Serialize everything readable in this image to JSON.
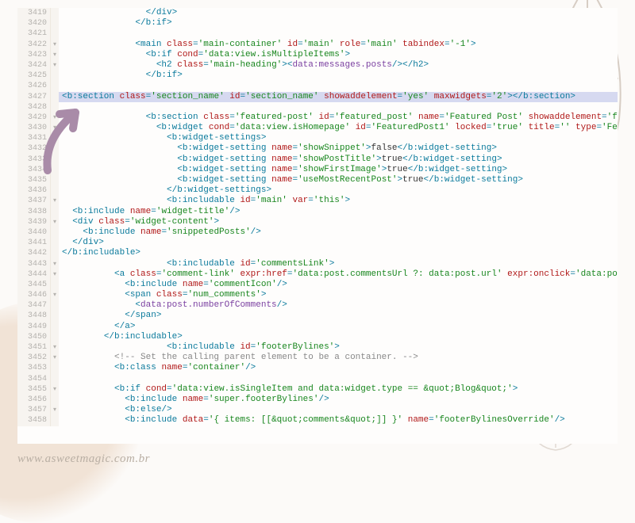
{
  "watermark": "www.asweetmagic.com.br",
  "lines": [
    {
      "num": "3419",
      "fold": "",
      "hl": false,
      "tokens": [
        [
          "t-text",
          "                "
        ],
        [
          "t-tag",
          "</div>"
        ]
      ]
    },
    {
      "num": "3420",
      "fold": "",
      "hl": false,
      "tokens": [
        [
          "t-text",
          "              "
        ],
        [
          "t-tag",
          "</b:if>"
        ]
      ]
    },
    {
      "num": "3421",
      "fold": "",
      "hl": false,
      "tokens": []
    },
    {
      "num": "3422",
      "fold": "▾",
      "hl": false,
      "tokens": [
        [
          "t-text",
          "              "
        ],
        [
          "t-tag",
          "<main "
        ],
        [
          "t-attr",
          "class"
        ],
        [
          "t-tag",
          "="
        ],
        [
          "t-str",
          "'main-container'"
        ],
        [
          "t-tag",
          " "
        ],
        [
          "t-attr",
          "id"
        ],
        [
          "t-tag",
          "="
        ],
        [
          "t-str",
          "'main'"
        ],
        [
          "t-tag",
          " "
        ],
        [
          "t-attr",
          "role"
        ],
        [
          "t-tag",
          "="
        ],
        [
          "t-str",
          "'main'"
        ],
        [
          "t-tag",
          " "
        ],
        [
          "t-attr",
          "tabindex"
        ],
        [
          "t-tag",
          "="
        ],
        [
          "t-str",
          "'-1'"
        ],
        [
          "t-tag",
          ">"
        ]
      ]
    },
    {
      "num": "3423",
      "fold": "▾",
      "hl": false,
      "tokens": [
        [
          "t-text",
          "                "
        ],
        [
          "t-tag",
          "<b:if "
        ],
        [
          "t-attr",
          "cond"
        ],
        [
          "t-tag",
          "="
        ],
        [
          "t-str",
          "'data:view.isMultipleItems'"
        ],
        [
          "t-tag",
          ">"
        ]
      ]
    },
    {
      "num": "3424",
      "fold": "▾",
      "hl": false,
      "tokens": [
        [
          "t-text",
          "                  "
        ],
        [
          "t-tag",
          "<h2 "
        ],
        [
          "t-attr",
          "class"
        ],
        [
          "t-tag",
          "="
        ],
        [
          "t-str",
          "'main-heading'"
        ],
        [
          "t-tag",
          "><"
        ],
        [
          "t-func",
          "data:messages.posts"
        ],
        [
          "t-tag",
          "/></h2>"
        ]
      ]
    },
    {
      "num": "3425",
      "fold": "",
      "hl": false,
      "tokens": [
        [
          "t-text",
          "                "
        ],
        [
          "t-tag",
          "</b:if>"
        ]
      ]
    },
    {
      "num": "3426",
      "fold": "",
      "hl": false,
      "tokens": []
    },
    {
      "num": "3427",
      "fold": "",
      "hl": true,
      "tokens": [
        [
          "t-tag",
          "<b:section "
        ],
        [
          "t-attr",
          "class"
        ],
        [
          "t-tag",
          "="
        ],
        [
          "t-str",
          "'section_name'"
        ],
        [
          "t-tag",
          " "
        ],
        [
          "t-attr",
          "id"
        ],
        [
          "t-tag",
          "="
        ],
        [
          "t-str",
          "'section_name'"
        ],
        [
          "t-tag",
          " "
        ],
        [
          "t-attr",
          "showaddelement"
        ],
        [
          "t-tag",
          "="
        ],
        [
          "t-str",
          "'yes'"
        ],
        [
          "t-tag",
          " "
        ],
        [
          "t-attr",
          "maxwidgets"
        ],
        [
          "t-tag",
          "="
        ],
        [
          "t-str",
          "'2'"
        ],
        [
          "t-tag",
          "></b:section>"
        ]
      ]
    },
    {
      "num": "3428",
      "fold": "",
      "hl": false,
      "tokens": []
    },
    {
      "num": "3429",
      "fold": "▾",
      "hl": false,
      "tokens": [
        [
          "t-text",
          "                "
        ],
        [
          "t-tag",
          "<b:section "
        ],
        [
          "t-attr",
          "class"
        ],
        [
          "t-tag",
          "="
        ],
        [
          "t-str",
          "'featured-post'"
        ],
        [
          "t-tag",
          " "
        ],
        [
          "t-attr",
          "id"
        ],
        [
          "t-tag",
          "="
        ],
        [
          "t-str",
          "'featured_post'"
        ],
        [
          "t-tag",
          " "
        ],
        [
          "t-attr",
          "name"
        ],
        [
          "t-tag",
          "="
        ],
        [
          "t-str",
          "'Featured Post'"
        ],
        [
          "t-tag",
          " "
        ],
        [
          "t-attr",
          "showaddelement"
        ],
        [
          "t-tag",
          "="
        ],
        [
          "t-str",
          "'false'"
        ],
        [
          "t-tag",
          ">"
        ]
      ]
    },
    {
      "num": "3430",
      "fold": "▾",
      "hl": false,
      "tokens": [
        [
          "t-text",
          "                  "
        ],
        [
          "t-tag",
          "<b:widget "
        ],
        [
          "t-attr",
          "cond"
        ],
        [
          "t-tag",
          "="
        ],
        [
          "t-str",
          "'data:view.isHomepage'"
        ],
        [
          "t-tag",
          " "
        ],
        [
          "t-attr",
          "id"
        ],
        [
          "t-tag",
          "="
        ],
        [
          "t-str",
          "'FeaturedPost1'"
        ],
        [
          "t-tag",
          " "
        ],
        [
          "t-attr",
          "locked"
        ],
        [
          "t-tag",
          "="
        ],
        [
          "t-str",
          "'true'"
        ],
        [
          "t-tag",
          " "
        ],
        [
          "t-attr",
          "title"
        ],
        [
          "t-tag",
          "="
        ],
        [
          "t-str",
          "''"
        ],
        [
          "t-tag",
          " "
        ],
        [
          "t-attr",
          "type"
        ],
        [
          "t-tag",
          "="
        ],
        [
          "t-str",
          "'Featured"
        ]
      ]
    },
    {
      "num": "3431",
      "fold": "▾",
      "hl": false,
      "tokens": [
        [
          "t-text",
          "                    "
        ],
        [
          "t-tag",
          "<b:widget-settings>"
        ]
      ]
    },
    {
      "num": "3432",
      "fold": "",
      "hl": false,
      "tokens": [
        [
          "t-text",
          "                      "
        ],
        [
          "t-tag",
          "<b:widget-setting "
        ],
        [
          "t-attr",
          "name"
        ],
        [
          "t-tag",
          "="
        ],
        [
          "t-str",
          "'showSnippet'"
        ],
        [
          "t-tag",
          ">"
        ],
        [
          "t-text",
          "false"
        ],
        [
          "t-tag",
          "</b:widget-setting>"
        ]
      ]
    },
    {
      "num": "3433",
      "fold": "",
      "hl": false,
      "tokens": [
        [
          "t-text",
          "                      "
        ],
        [
          "t-tag",
          "<b:widget-setting "
        ],
        [
          "t-attr",
          "name"
        ],
        [
          "t-tag",
          "="
        ],
        [
          "t-str",
          "'showPostTitle'"
        ],
        [
          "t-tag",
          ">"
        ],
        [
          "t-text",
          "true"
        ],
        [
          "t-tag",
          "</b:widget-setting>"
        ]
      ]
    },
    {
      "num": "3434",
      "fold": "",
      "hl": false,
      "tokens": [
        [
          "t-text",
          "                      "
        ],
        [
          "t-tag",
          "<b:widget-setting "
        ],
        [
          "t-attr",
          "name"
        ],
        [
          "t-tag",
          "="
        ],
        [
          "t-str",
          "'showFirstImage'"
        ],
        [
          "t-tag",
          ">"
        ],
        [
          "t-text",
          "true"
        ],
        [
          "t-tag",
          "</b:widget-setting>"
        ]
      ]
    },
    {
      "num": "3435",
      "fold": "",
      "hl": false,
      "tokens": [
        [
          "t-text",
          "                      "
        ],
        [
          "t-tag",
          "<b:widget-setting "
        ],
        [
          "t-attr",
          "name"
        ],
        [
          "t-tag",
          "="
        ],
        [
          "t-str",
          "'useMostRecentPost'"
        ],
        [
          "t-tag",
          ">"
        ],
        [
          "t-text",
          "true"
        ],
        [
          "t-tag",
          "</b:widget-setting>"
        ]
      ]
    },
    {
      "num": "3436",
      "fold": "",
      "hl": false,
      "tokens": [
        [
          "t-text",
          "                    "
        ],
        [
          "t-tag",
          "</b:widget-settings>"
        ]
      ]
    },
    {
      "num": "3437",
      "fold": "▾",
      "hl": false,
      "tokens": [
        [
          "t-text",
          "                    "
        ],
        [
          "t-tag",
          "<b:includable "
        ],
        [
          "t-attr",
          "id"
        ],
        [
          "t-tag",
          "="
        ],
        [
          "t-str",
          "'main'"
        ],
        [
          "t-tag",
          " "
        ],
        [
          "t-attr",
          "var"
        ],
        [
          "t-tag",
          "="
        ],
        [
          "t-str",
          "'this'"
        ],
        [
          "t-tag",
          ">"
        ]
      ]
    },
    {
      "num": "3438",
      "fold": "",
      "hl": false,
      "tokens": [
        [
          "t-text",
          "  "
        ],
        [
          "t-tag",
          "<b:include "
        ],
        [
          "t-attr",
          "name"
        ],
        [
          "t-tag",
          "="
        ],
        [
          "t-str",
          "'widget-title'"
        ],
        [
          "t-tag",
          "/>"
        ]
      ]
    },
    {
      "num": "3439",
      "fold": "▾",
      "hl": false,
      "tokens": [
        [
          "t-text",
          "  "
        ],
        [
          "t-tag",
          "<div "
        ],
        [
          "t-attr",
          "class"
        ],
        [
          "t-tag",
          "="
        ],
        [
          "t-str",
          "'widget-content'"
        ],
        [
          "t-tag",
          ">"
        ]
      ]
    },
    {
      "num": "3440",
      "fold": "",
      "hl": false,
      "tokens": [
        [
          "t-text",
          "    "
        ],
        [
          "t-tag",
          "<b:include "
        ],
        [
          "t-attr",
          "name"
        ],
        [
          "t-tag",
          "="
        ],
        [
          "t-str",
          "'snippetedPosts'"
        ],
        [
          "t-tag",
          "/>"
        ]
      ]
    },
    {
      "num": "3441",
      "fold": "",
      "hl": false,
      "tokens": [
        [
          "t-text",
          "  "
        ],
        [
          "t-tag",
          "</div>"
        ]
      ]
    },
    {
      "num": "3442",
      "fold": "",
      "hl": false,
      "tokens": [
        [
          "t-tag",
          "</b:includable>"
        ]
      ]
    },
    {
      "num": "3443",
      "fold": "▾",
      "hl": false,
      "tokens": [
        [
          "t-text",
          "                    "
        ],
        [
          "t-tag",
          "<b:includable "
        ],
        [
          "t-attr",
          "id"
        ],
        [
          "t-tag",
          "="
        ],
        [
          "t-str",
          "'commentsLink'"
        ],
        [
          "t-tag",
          ">"
        ]
      ]
    },
    {
      "num": "3444",
      "fold": "▾",
      "hl": false,
      "tokens": [
        [
          "t-text",
          "          "
        ],
        [
          "t-tag",
          "<a "
        ],
        [
          "t-attr",
          "class"
        ],
        [
          "t-tag",
          "="
        ],
        [
          "t-str",
          "'comment-link'"
        ],
        [
          "t-tag",
          " "
        ],
        [
          "t-attr",
          "expr:href"
        ],
        [
          "t-tag",
          "="
        ],
        [
          "t-str",
          "'data:post.commentsUrl ?: data:post.url'"
        ],
        [
          "t-tag",
          " "
        ],
        [
          "t-attr",
          "expr:onclick"
        ],
        [
          "t-tag",
          "="
        ],
        [
          "t-str",
          "'data:post.com"
        ]
      ]
    },
    {
      "num": "3445",
      "fold": "",
      "hl": false,
      "tokens": [
        [
          "t-text",
          "            "
        ],
        [
          "t-tag",
          "<b:include "
        ],
        [
          "t-attr",
          "name"
        ],
        [
          "t-tag",
          "="
        ],
        [
          "t-str",
          "'commentIcon'"
        ],
        [
          "t-tag",
          "/>"
        ]
      ]
    },
    {
      "num": "3446",
      "fold": "▾",
      "hl": false,
      "tokens": [
        [
          "t-text",
          "            "
        ],
        [
          "t-tag",
          "<span "
        ],
        [
          "t-attr",
          "class"
        ],
        [
          "t-tag",
          "="
        ],
        [
          "t-str",
          "'num_comments'"
        ],
        [
          "t-tag",
          ">"
        ]
      ]
    },
    {
      "num": "3447",
      "fold": "",
      "hl": false,
      "tokens": [
        [
          "t-text",
          "              "
        ],
        [
          "t-tag",
          "<"
        ],
        [
          "t-func",
          "data:post.numberOfComments"
        ],
        [
          "t-tag",
          "/>"
        ]
      ]
    },
    {
      "num": "3448",
      "fold": "",
      "hl": false,
      "tokens": [
        [
          "t-text",
          "            "
        ],
        [
          "t-tag",
          "</span>"
        ]
      ]
    },
    {
      "num": "3449",
      "fold": "",
      "hl": false,
      "tokens": [
        [
          "t-text",
          "          "
        ],
        [
          "t-tag",
          "</a>"
        ]
      ]
    },
    {
      "num": "3450",
      "fold": "",
      "hl": false,
      "tokens": [
        [
          "t-text",
          "        "
        ],
        [
          "t-tag",
          "</b:includable>"
        ]
      ]
    },
    {
      "num": "3451",
      "fold": "▾",
      "hl": false,
      "tokens": [
        [
          "t-text",
          "                    "
        ],
        [
          "t-tag",
          "<b:includable "
        ],
        [
          "t-attr",
          "id"
        ],
        [
          "t-tag",
          "="
        ],
        [
          "t-str",
          "'footerBylines'"
        ],
        [
          "t-tag",
          ">"
        ]
      ]
    },
    {
      "num": "3452",
      "fold": "▾",
      "hl": false,
      "tokens": [
        [
          "t-text",
          "          "
        ],
        [
          "t-cmt",
          "<!-- Set the calling parent element to be a container. -->"
        ]
      ]
    },
    {
      "num": "3453",
      "fold": "",
      "hl": false,
      "tokens": [
        [
          "t-text",
          "          "
        ],
        [
          "t-tag",
          "<b:class "
        ],
        [
          "t-attr",
          "name"
        ],
        [
          "t-tag",
          "="
        ],
        [
          "t-str",
          "'container'"
        ],
        [
          "t-tag",
          "/>"
        ]
      ]
    },
    {
      "num": "3454",
      "fold": "",
      "hl": false,
      "tokens": []
    },
    {
      "num": "3455",
      "fold": "▾",
      "hl": false,
      "tokens": [
        [
          "t-text",
          "          "
        ],
        [
          "t-tag",
          "<b:if "
        ],
        [
          "t-attr",
          "cond"
        ],
        [
          "t-tag",
          "="
        ],
        [
          "t-str",
          "'data:view.isSingleItem and data:widget.type == &quot;Blog&quot;'"
        ],
        [
          "t-tag",
          ">"
        ]
      ]
    },
    {
      "num": "3456",
      "fold": "",
      "hl": false,
      "tokens": [
        [
          "t-text",
          "            "
        ],
        [
          "t-tag",
          "<b:include "
        ],
        [
          "t-attr",
          "name"
        ],
        [
          "t-tag",
          "="
        ],
        [
          "t-str",
          "'super.footerBylines'"
        ],
        [
          "t-tag",
          "/>"
        ]
      ]
    },
    {
      "num": "3457",
      "fold": "▾",
      "hl": false,
      "tokens": [
        [
          "t-text",
          "            "
        ],
        [
          "t-tag",
          "<b:else/>"
        ]
      ]
    },
    {
      "num": "3458",
      "fold": "",
      "hl": false,
      "tokens": [
        [
          "t-text",
          "            "
        ],
        [
          "t-tag",
          "<b:include "
        ],
        [
          "t-attr",
          "data"
        ],
        [
          "t-tag",
          "="
        ],
        [
          "t-str",
          "'{ items: [[&quot;comments&quot;]] }'"
        ],
        [
          "t-tag",
          " "
        ],
        [
          "t-attr",
          "name"
        ],
        [
          "t-tag",
          "="
        ],
        [
          "t-str",
          "'footerBylinesOverride'"
        ],
        [
          "t-tag",
          "/>"
        ]
      ]
    }
  ]
}
